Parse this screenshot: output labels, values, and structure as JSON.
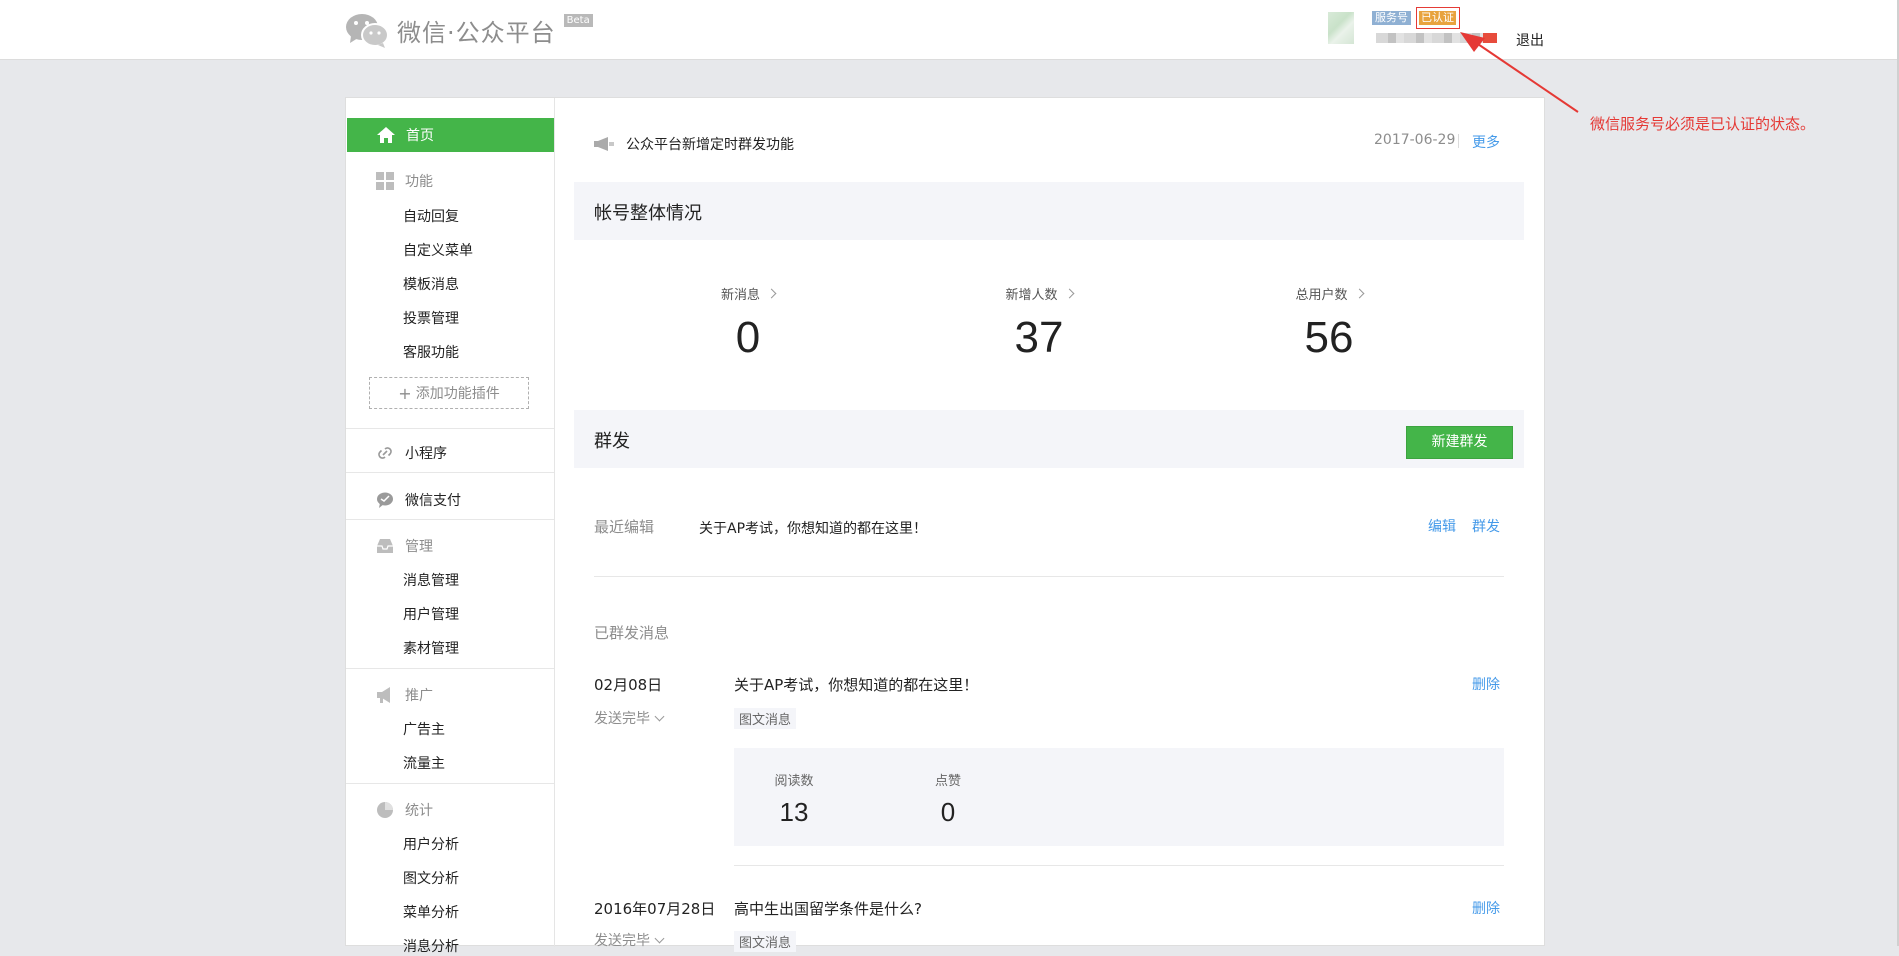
{
  "header": {
    "logo_text": "微信·公众平台",
    "beta": "Beta",
    "account_type": "服务号",
    "verified": "已认证",
    "logout": "退出"
  },
  "annotation": {
    "text": "微信服务号必须是已认证的状态。",
    "color": "#e53935"
  },
  "sidebar": {
    "home": "首页",
    "features": {
      "title": "功能",
      "items": [
        "自动回复",
        "自定义菜单",
        "模板消息",
        "投票管理",
        "客服功能"
      ]
    },
    "add_plugin": "添加功能插件",
    "mini_program": "小程序",
    "wechat_pay": "微信支付",
    "manage": {
      "title": "管理",
      "items": [
        "消息管理",
        "用户管理",
        "素材管理"
      ]
    },
    "promote": {
      "title": "推广",
      "items": [
        "广告主",
        "流量主"
      ]
    },
    "stats": {
      "title": "统计",
      "items": [
        "用户分析",
        "图文分析",
        "菜单分析",
        "消息分析"
      ]
    }
  },
  "notice": {
    "text": "公众平台新增定时群发功能",
    "date": "2017-06-29",
    "more": "更多"
  },
  "overview": {
    "title": "帐号整体情况",
    "stats": [
      {
        "label": "新消息",
        "value": "0"
      },
      {
        "label": "新增人数",
        "value": "37"
      },
      {
        "label": "总用户数",
        "value": "56"
      }
    ]
  },
  "mass": {
    "title": "群发",
    "new_button": "新建群发",
    "recent_label": "最近编辑",
    "recent_title": "关于AP考试，你想知道的都在这里！",
    "edit": "编辑",
    "send": "群发",
    "sent_label": "已群发消息",
    "messages": [
      {
        "date": "02月08日",
        "status": "发送完毕",
        "title": "关于AP考试，你想知道的都在这里！",
        "tag": "图文消息",
        "delete": "删除",
        "read_label": "阅读数",
        "read": "13",
        "like_label": "点赞",
        "like": "0"
      },
      {
        "date": "2016年07月28日",
        "status": "发送完毕",
        "title": "高中生出国留学条件是什么?",
        "tag": "图文消息",
        "delete": "删除"
      }
    ]
  },
  "colors": {
    "brand_green": "#44b549",
    "link_blue": "#459ae9",
    "annotation_red": "#e53935"
  }
}
